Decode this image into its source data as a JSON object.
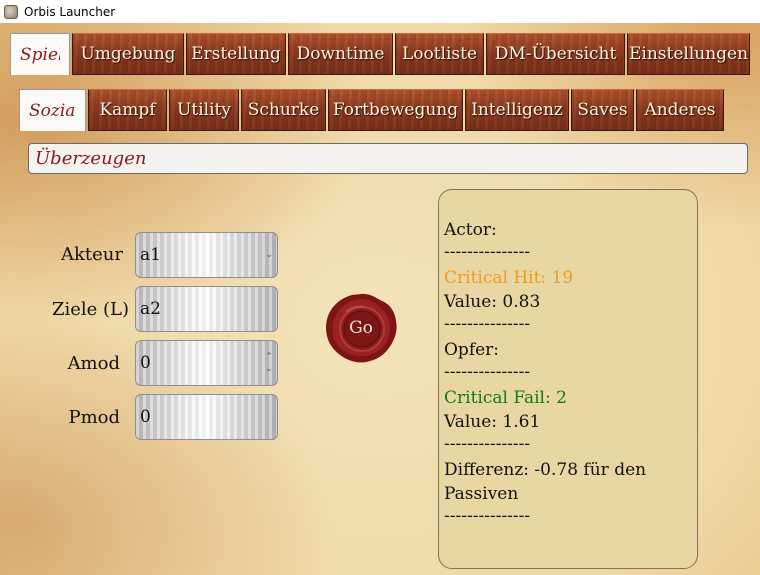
{
  "window": {
    "title": "Orbis Launcher"
  },
  "main_tabs": [
    "Spiel",
    "Umgebung",
    "Erstellung",
    "Downtime",
    "Lootliste",
    "DM-Übersicht",
    "Einstellungen"
  ],
  "sub_tabs": [
    "Sozial",
    "Kampf",
    "Utility",
    "Schurke",
    "Fortbewegung",
    "Intelligenz",
    "Saves",
    "Anderes"
  ],
  "skill_bar": {
    "value": "Überzeugen"
  },
  "form": {
    "akteur": {
      "label": "Akteur",
      "value": "a1"
    },
    "ziele": {
      "label": "Ziele (L)",
      "value": "a2"
    },
    "amod": {
      "label": "Amod",
      "value": "0"
    },
    "pmod": {
      "label": "Pmod",
      "value": "0"
    }
  },
  "go_button": {
    "label": "Go"
  },
  "result": {
    "actor_heading": "Actor:",
    "separator": "---------------",
    "actor_critical": "Critical Hit: 19",
    "actor_value": "Value: 0.83",
    "victim_heading": "Opfer:",
    "victim_critical": "Critical Fail: 2",
    "victim_value": "Value: 1.61",
    "difference": "Differenz: -0.78 für den Passiven"
  },
  "colors": {
    "critical_hit": "#f09a1e",
    "critical_fail": "#147a14",
    "active_tab_text": "#8b1a1a",
    "wax_seal": "#8e1d1d"
  }
}
